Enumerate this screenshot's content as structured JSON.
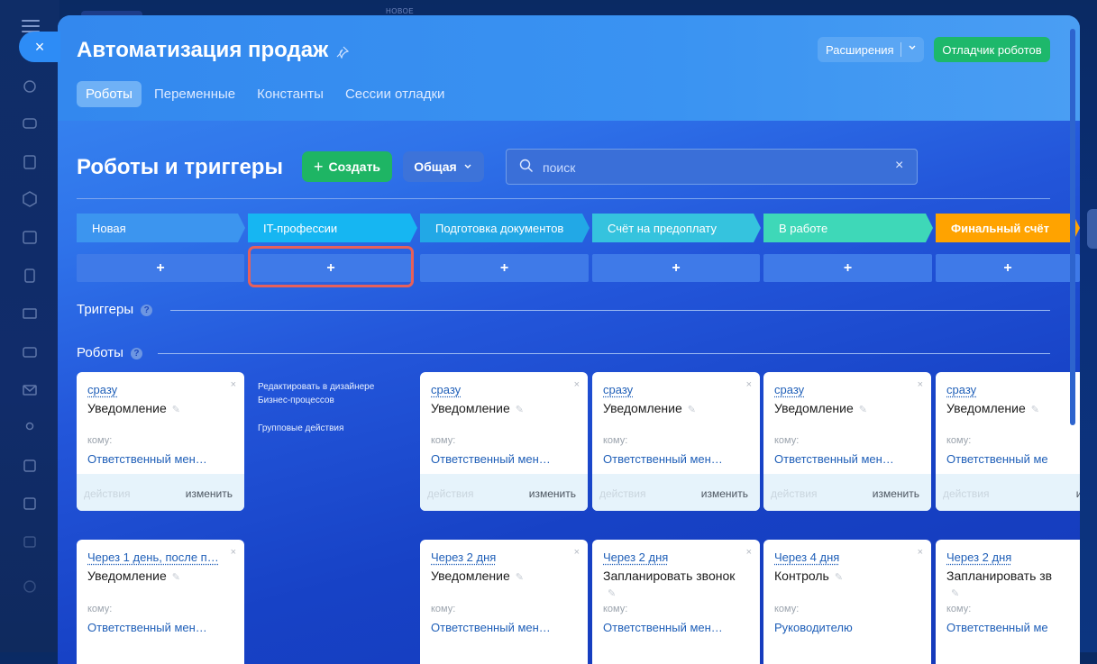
{
  "top_label": "НОВОЕ",
  "page": {
    "title": "Автоматизация продаж",
    "extensions_label": "Расширения",
    "debugger_label": "Отладчик роботов",
    "tabs": [
      {
        "label": "Роботы",
        "active": true
      },
      {
        "label": "Переменные"
      },
      {
        "label": "Константы"
      },
      {
        "label": "Сессии отладки"
      }
    ]
  },
  "toolbar": {
    "heading": "Роботы и триггеры",
    "create_label": "Создать",
    "general_label": "Общая",
    "search_placeholder": "поиск"
  },
  "stages": [
    {
      "name": "Новая",
      "color": "#3c95ef"
    },
    {
      "name": "IT-профессии",
      "color": "#16b6f2"
    },
    {
      "name": "Подготовка документов",
      "color": "#22a8e6"
    },
    {
      "name": "Счёт на предоплату",
      "color": "#35c3de"
    },
    {
      "name": "В работе",
      "color": "#3ed8b8"
    },
    {
      "name": "Финальный счёт",
      "color": "#ffa300"
    }
  ],
  "add_symbol": "+",
  "sections": {
    "triggers": "Триггеры",
    "robots": "Роботы",
    "help": "?"
  },
  "side_links": {
    "edit_in_designer": "Редактировать в дизайнере Бизнес-процессов",
    "group_actions": "Групповые действия"
  },
  "card_labels": {
    "to": "кому:",
    "actions": "действия",
    "edit": "изменить",
    "close": "×",
    "pencil": "✎"
  },
  "robots_row1": [
    {
      "when": "сразу",
      "title": "Уведомление",
      "to": "Ответственный мен…"
    },
    {
      "when": "сразу",
      "title": "Уведомление",
      "to": "Ответственный мен…"
    },
    {
      "when": "сразу",
      "title": "Уведомление",
      "to": "Ответственный мен…"
    },
    {
      "when": "сразу",
      "title": "Уведомление",
      "to": "Ответственный мен…"
    },
    {
      "when": "сразу",
      "title": "Уведомление",
      "to": "Ответственный ме"
    }
  ],
  "robots_row2": [
    {
      "when": "Через 1 день, после п…",
      "title": "Уведомление",
      "to": "Ответственный мен…"
    },
    {
      "when": "Через 2 дня",
      "title": "Уведомление",
      "to": "Ответственный мен…"
    },
    {
      "when": "Через 2 дня",
      "title": "Запланировать звонок",
      "to": "Ответственный мен…"
    },
    {
      "when": "Через 4 дня",
      "title": "Контроль",
      "to": "Руководителю"
    },
    {
      "when": "Через 2 дня",
      "title": "Запланировать зв",
      "to": "Ответственный ме"
    }
  ],
  "icons": {
    "close": "close-icon",
    "pin": "pin-icon",
    "search": "search-icon",
    "chevron": "chevron-down-icon",
    "help": "help-icon"
  }
}
